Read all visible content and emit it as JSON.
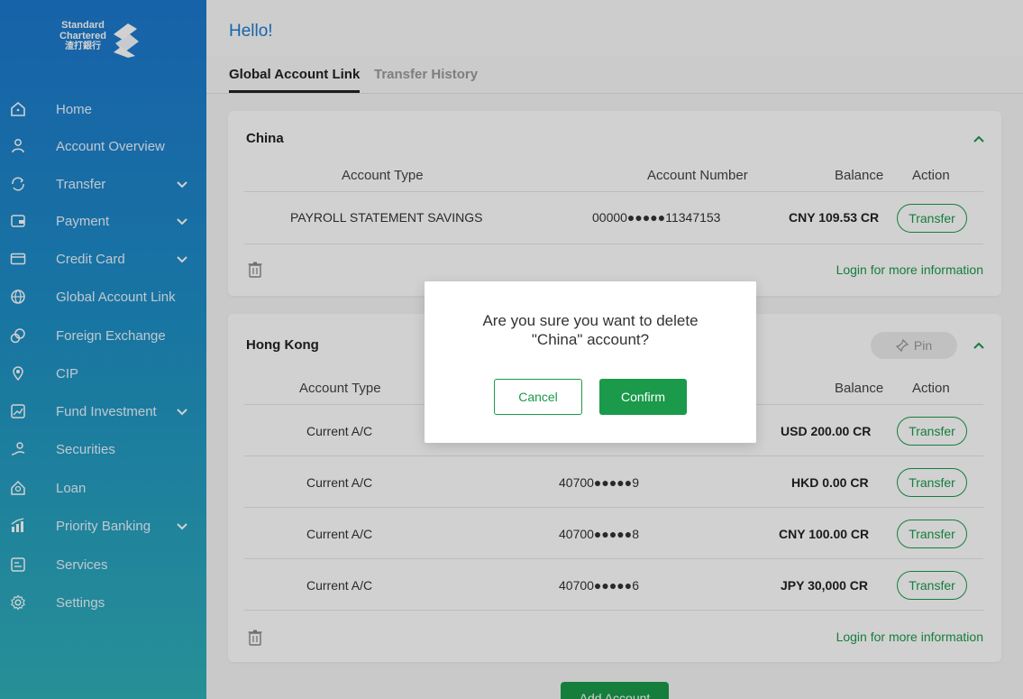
{
  "brand": {
    "line1": "Standard",
    "line2": "Chartered",
    "line3": "渣打銀行",
    "accent": "#1f7bd1",
    "green": "#1a9a4a"
  },
  "sidebar": {
    "items": [
      {
        "label": "Home",
        "icon": "home-icon"
      },
      {
        "label": "Account Overview",
        "icon": "person-icon"
      },
      {
        "label": "Transfer",
        "icon": "transfer-icon",
        "expandable": true
      },
      {
        "label": "Payment",
        "icon": "wallet-icon",
        "expandable": true
      },
      {
        "label": "Credit Card",
        "icon": "credit-card-icon",
        "expandable": true
      },
      {
        "label": "Global Account Link",
        "icon": "globe-icon"
      },
      {
        "label": "Foreign Exchange",
        "icon": "exchange-icon"
      },
      {
        "label": "CIP",
        "icon": "location-icon"
      },
      {
        "label": "Fund Investment",
        "icon": "chart-icon",
        "expandable": true
      },
      {
        "label": "Securities",
        "icon": "securities-icon"
      },
      {
        "label": "Loan",
        "icon": "loan-icon"
      },
      {
        "label": "Priority Banking",
        "icon": "bar-chart-icon",
        "expandable": true
      },
      {
        "label": "Services",
        "icon": "services-icon"
      },
      {
        "label": "Settings",
        "icon": "gear-icon"
      }
    ]
  },
  "header": {
    "greeting": "Hello!"
  },
  "tabs": [
    {
      "label": "Global Account Link"
    },
    {
      "label": "Transfer History"
    }
  ],
  "columns": {
    "account_type": "Account Type",
    "account_number": "Account Number",
    "balance": "Balance",
    "action": "Action"
  },
  "cards": {
    "china": {
      "title": "China",
      "rows": [
        {
          "type": "PAYROLL STATEMENT SAVINGS",
          "number": "00000●●●●●11347153",
          "balance": "CNY 109.53 CR",
          "action": "Transfer"
        }
      ],
      "login_link": "Login for more information"
    },
    "hongkong": {
      "title": "Hong Kong",
      "pin_label": "Pin",
      "rows": [
        {
          "type": "Current A/C",
          "number": "",
          "balance": "USD 200.00 CR",
          "action": "Transfer"
        },
        {
          "type": "Current A/C",
          "number": "40700●●●●●9",
          "balance": "HKD 0.00 CR",
          "action": "Transfer"
        },
        {
          "type": "Current A/C",
          "number": "40700●●●●●8",
          "balance": "CNY 100.00 CR",
          "action": "Transfer"
        },
        {
          "type": "Current A/C",
          "number": "40700●●●●●6",
          "balance": "JPY 30,000 CR",
          "action": "Transfer"
        }
      ],
      "login_link": "Login for more information"
    }
  },
  "add_account_label": "Add Account",
  "modal": {
    "line1": "Are you sure you want to delete",
    "line2": "\"China\" account?",
    "cancel_label": "Cancel",
    "confirm_label": "Confirm"
  }
}
